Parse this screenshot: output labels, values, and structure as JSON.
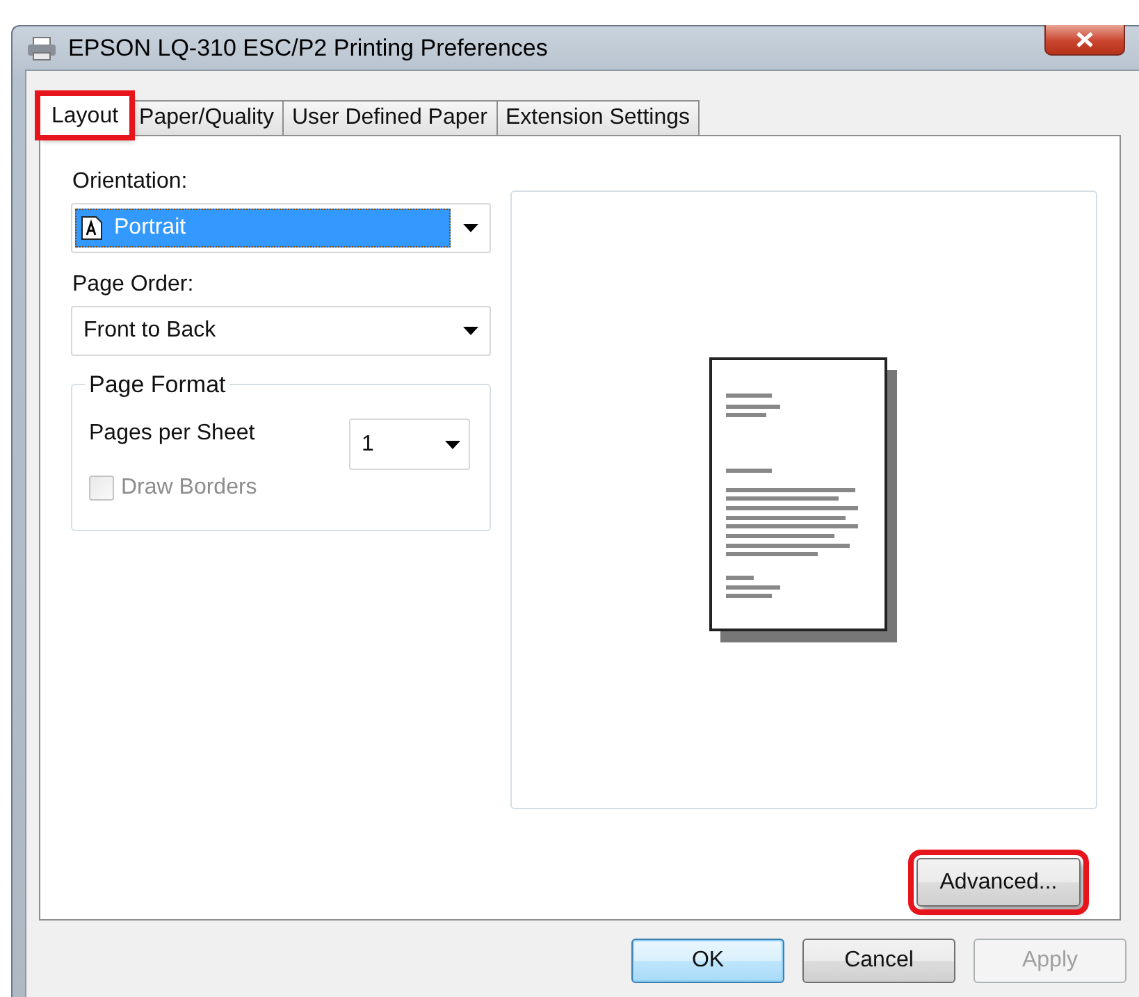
{
  "window": {
    "title": "EPSON LQ-310 ESC/P2 Printing Preferences"
  },
  "tabs": [
    {
      "label": "Layout",
      "selected": true,
      "highlighted": true
    },
    {
      "label": "Paper/Quality",
      "selected": false,
      "highlighted": false
    },
    {
      "label": "User Defined Paper",
      "selected": false,
      "highlighted": false
    },
    {
      "label": "Extension Settings",
      "selected": false,
      "highlighted": false
    }
  ],
  "orientation": {
    "label": "Orientation:",
    "value": "Portrait",
    "focused": true
  },
  "page_order": {
    "label": "Page Order:",
    "value": "Front to Back",
    "focused": false
  },
  "page_format": {
    "title": "Page Format",
    "pages_per_sheet": {
      "label": "Pages per Sheet",
      "value": "1"
    },
    "draw_borders": {
      "label": "Draw Borders",
      "checked": false,
      "disabled": true
    }
  },
  "advanced_button": {
    "label": "Advanced...",
    "highlighted": true
  },
  "buttons": [
    {
      "label": "OK",
      "kind": "default",
      "disabled": false
    },
    {
      "label": "Cancel",
      "kind": "normal",
      "disabled": false
    },
    {
      "label": "Apply",
      "kind": "normal",
      "disabled": true
    }
  ]
}
